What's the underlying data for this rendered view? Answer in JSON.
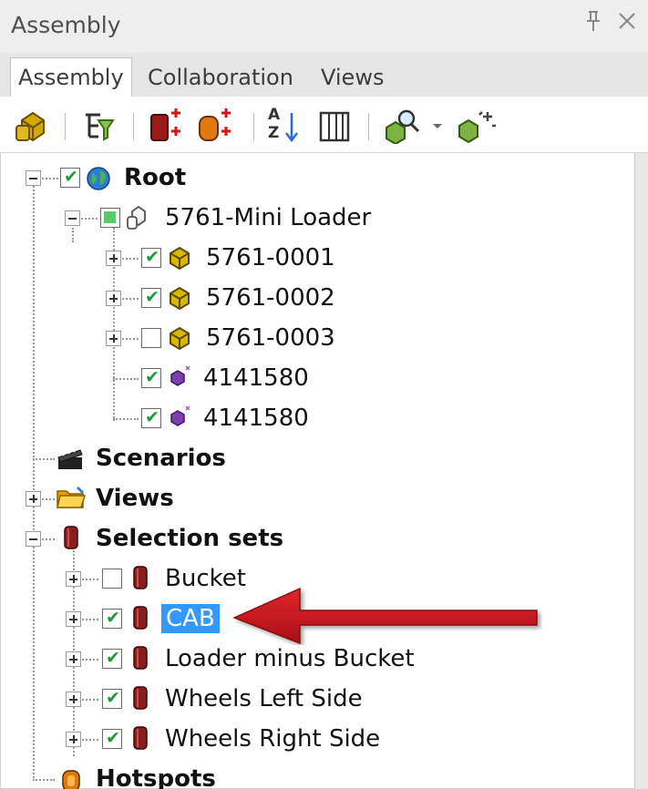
{
  "panel": {
    "title": "Assembly",
    "pin_glyph": "Ͱ",
    "close_glyph": "✕"
  },
  "tabs": [
    {
      "label": "Assembly",
      "active": true
    },
    {
      "label": "Collaboration",
      "active": false
    },
    {
      "label": "Views",
      "active": false
    }
  ],
  "toolbar": {
    "icons": [
      "open-assembly-icon",
      "filter-tree-icon",
      "add-selection-set-icon",
      "add-hotspot-icon",
      "sort-az-icon",
      "columns-icon",
      "find-icon",
      "dropdown-icon",
      "explode-icon"
    ],
    "sort_top": "A",
    "sort_bottom": "Z"
  },
  "tree": {
    "root": {
      "label": "Root",
      "checked": true
    },
    "assembly": {
      "label": "5761-Mini Loader",
      "state": "partial"
    },
    "parts": [
      {
        "label": "5761-0001",
        "checked": true,
        "expandable": true
      },
      {
        "label": "5761-0002",
        "checked": true,
        "expandable": true
      },
      {
        "label": "5761-0003",
        "checked": false,
        "expandable": true
      },
      {
        "label": "4141580",
        "checked": true,
        "expandable": false
      },
      {
        "label": "4141580",
        "checked": true,
        "expandable": false
      }
    ],
    "scenarios": {
      "label": "Scenarios"
    },
    "views": {
      "label": "Views"
    },
    "selection_sets": {
      "label": "Selection sets"
    },
    "sets": [
      {
        "label": "Bucket",
        "checked": false,
        "selected": false
      },
      {
        "label": "CAB",
        "checked": true,
        "selected": true
      },
      {
        "label": "Loader minus Bucket",
        "checked": true,
        "selected": false
      },
      {
        "label": "Wheels Left Side",
        "checked": true,
        "selected": false
      },
      {
        "label": "Wheels Right Side",
        "checked": true,
        "selected": false
      }
    ],
    "hotspots": {
      "label": "Hotspots"
    }
  },
  "colors": {
    "selection": "#3399ff",
    "check": "#1e9a3a",
    "arrow": "#c8161d",
    "part_icon": "#d4b200",
    "set_icon": "#8b1d1d"
  },
  "checkmark": "✔"
}
